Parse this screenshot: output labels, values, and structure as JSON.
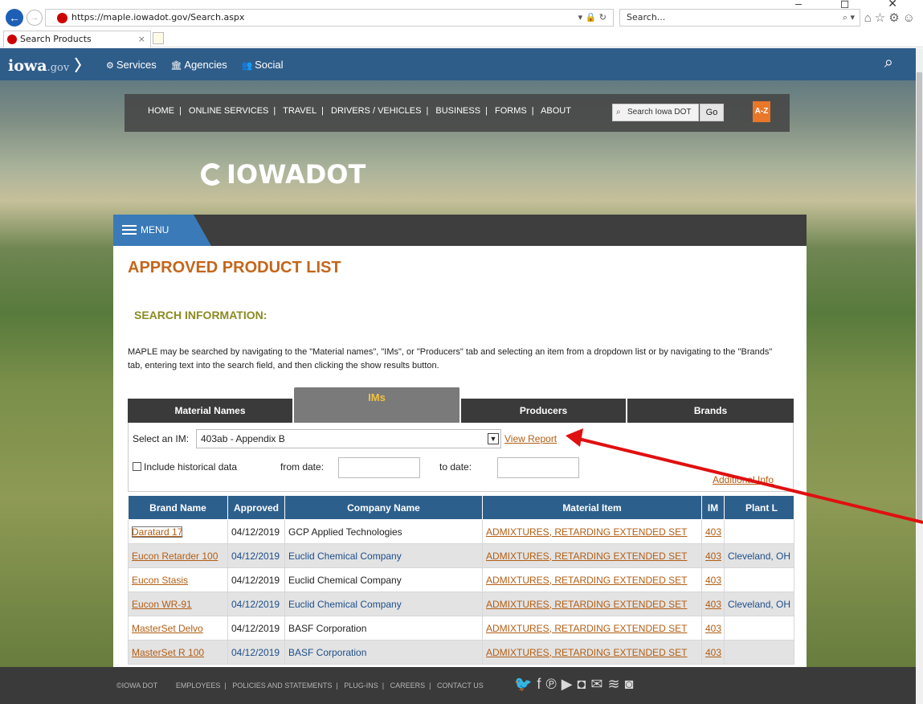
{
  "browser": {
    "url": "https://maple.iowadot.gov/Search.aspx",
    "search_placeholder": "Search...",
    "tab_title": "Search Products",
    "window_controls": "–  ◻  ✕",
    "tool_icons": "⌂☆⚙☺"
  },
  "topbar": {
    "logo": "iowa",
    "logo_suffix": ".gov",
    "nav": [
      {
        "label": "Services",
        "icon": "gear-icon"
      },
      {
        "label": "Agencies",
        "icon": "building-icon"
      },
      {
        "label": "Social",
        "icon": "people-icon"
      }
    ]
  },
  "dotnav": {
    "links": [
      "HOME",
      "ONLINE SERVICES",
      "TRAVEL",
      "DRIVERS / VEHICLES",
      "BUSINESS",
      "FORMS",
      "ABOUT"
    ],
    "search_placeholder": "Search Iowa DOT",
    "go_label": "Go",
    "az_label": "A-Z"
  },
  "brand": {
    "logo_text": "IOWADOT"
  },
  "menu": {
    "label": "MENU"
  },
  "main": {
    "title": "APPROVED PRODUCT LIST",
    "section_title": "SEARCH INFORMATION:",
    "intro": "MAPLE may be searched by navigating to the \"Material names\", \"IMs\", or \"Producers\" tab and selecting an item from a dropdown list or by navigating to the \"Brands\" tab, entering text into the search field, and then clicking the show results button.",
    "tabs": [
      {
        "label": "Material Names",
        "active": false
      },
      {
        "label": "IMs",
        "active": true
      },
      {
        "label": "Producers",
        "active": false
      },
      {
        "label": "Brands",
        "active": false
      }
    ],
    "filters": {
      "im_label": "Select an IM:",
      "im_value": "403ab - Appendix B",
      "view_report": "View Report",
      "historical_label": "Include historical data",
      "from_label": "from date:",
      "to_label": "to date:",
      "additional_info": "Additional Info"
    },
    "table": {
      "columns": [
        "Brand Name",
        "Approved",
        "Company Name",
        "Material Item",
        "IM",
        "Plant L"
      ],
      "rows": [
        [
          "Daratard 17",
          "04/12/2019",
          "GCP Applied Technologies",
          "ADMIXTURES, RETARDING EXTENDED SET",
          "403",
          ""
        ],
        [
          "Eucon Retarder 100",
          "04/12/2019",
          "Euclid Chemical Company",
          "ADMIXTURES, RETARDING EXTENDED SET",
          "403",
          "Cleveland, OH"
        ],
        [
          "Eucon Stasis",
          "04/12/2019",
          "Euclid Chemical Company",
          "ADMIXTURES, RETARDING EXTENDED SET",
          "403",
          ""
        ],
        [
          "Eucon WR-91",
          "04/12/2019",
          "Euclid Chemical Company",
          "ADMIXTURES, RETARDING EXTENDED SET",
          "403",
          "Cleveland, OH"
        ],
        [
          "MasterSet Delvo",
          "04/12/2019",
          "BASF Corporation",
          "ADMIXTURES, RETARDING EXTENDED SET",
          "403",
          ""
        ],
        [
          "MasterSet R 100",
          "04/12/2019",
          "BASF Corporation",
          "ADMIXTURES, RETARDING EXTENDED SET",
          "403",
          ""
        ]
      ]
    }
  },
  "footer": {
    "copyright": "©IOWA DOT",
    "links": [
      "EMPLOYEES",
      "POLICIES AND STATEMENTS",
      "PLUG-INS",
      "CAREERS",
      "CONTACT US"
    ]
  },
  "colors": {
    "topbar": "#2f5d8a",
    "accent_orange": "#c4661a",
    "link": "#b25e14",
    "table_header": "#2d5f8c",
    "annotation_arrow": "#e01010"
  }
}
